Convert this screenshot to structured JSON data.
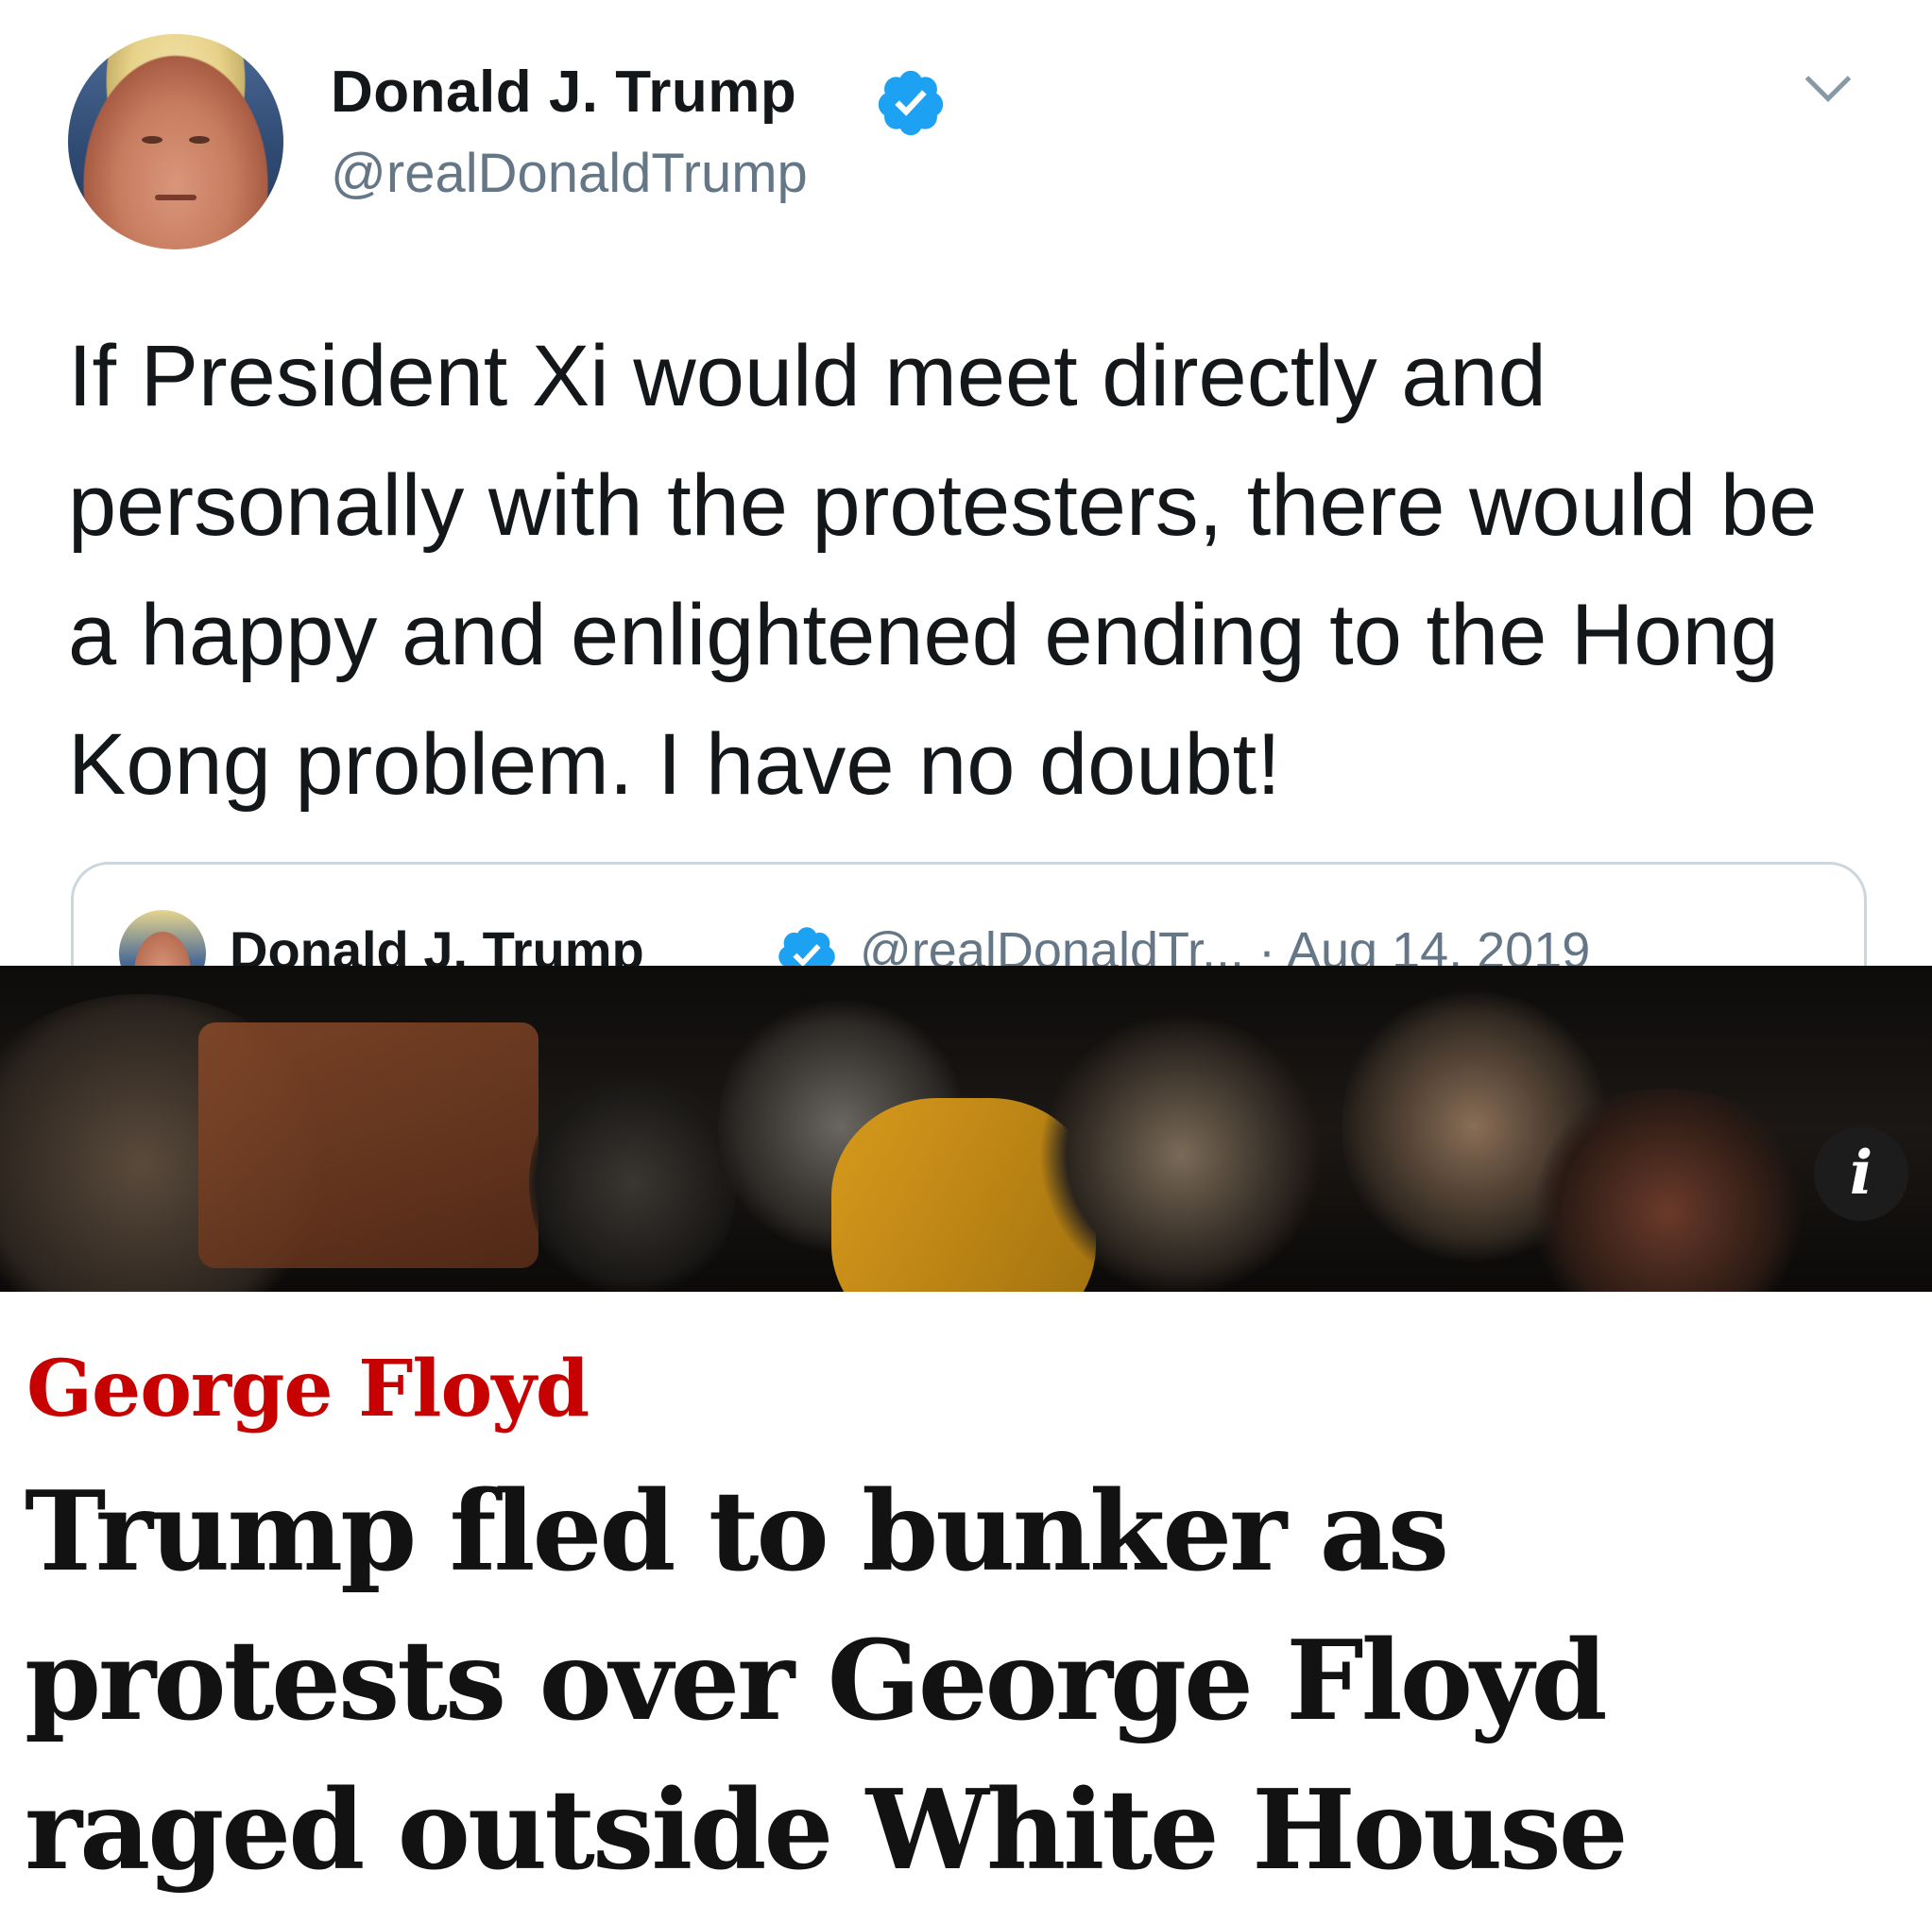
{
  "tweet": {
    "author_name": "Donald J. Trump",
    "author_handle": "@realDonaldTrump",
    "text": "If President Xi would meet directly and personally with the protesters, there would be a happy and enlightened ending to the Hong Kong problem. I have no doubt!",
    "icons": {
      "verified": "verified-badge-icon",
      "menu": "chevron-down-icon"
    },
    "colors": {
      "verified": "#1da1f2",
      "secondary_text": "#657786"
    },
    "quoted": {
      "author_name": "Donald J. Trump",
      "meta": "@realDonaldTr... · Aug 14, 2019"
    }
  },
  "article": {
    "photo_info_label": "i",
    "kicker": "George Floyd",
    "headline": "Trump fled to bunker as protests over George Floyd raged outside White House",
    "colors": {
      "kicker": "#c70000",
      "headline": "#121212"
    }
  }
}
